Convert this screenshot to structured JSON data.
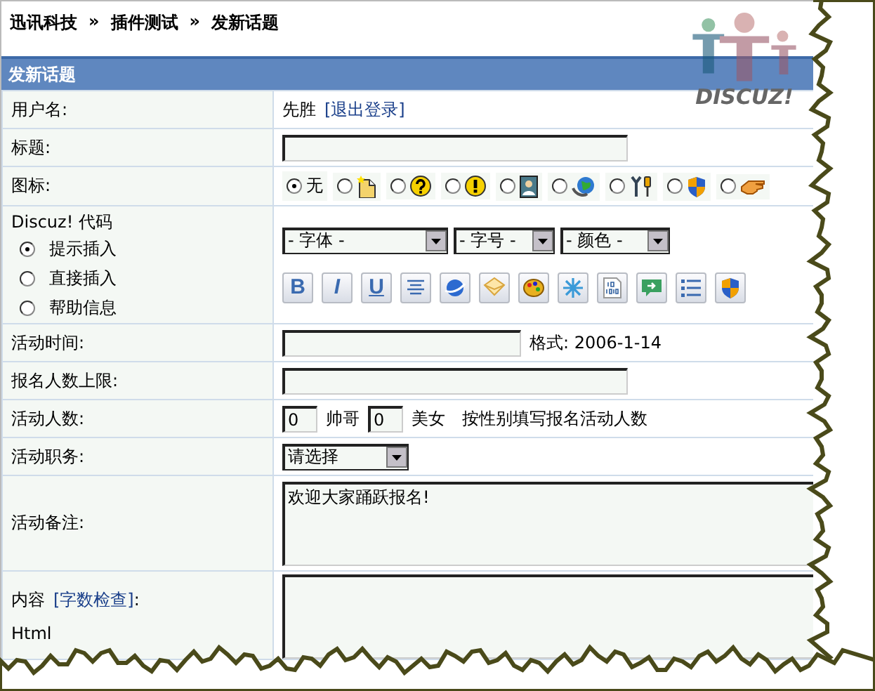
{
  "breadcrumb": [
    {
      "label": "迅讯科技"
    },
    {
      "separator": "»",
      "label": "插件测试"
    },
    {
      "separator": "»",
      "label": "发新话题"
    }
  ],
  "logo": {
    "text": "DISCUZ!"
  },
  "form": {
    "title": "发新话题",
    "rows": [
      {
        "kind": "user",
        "label": "用户名:",
        "user": "先胜",
        "link": "[退出登录]"
      },
      {
        "kind": "text",
        "label": "标题:",
        "value": ""
      },
      {
        "kind": "icons",
        "label": "图标:",
        "options": [
          {
            "text": "无",
            "selected": true
          },
          {
            "selected": false
          },
          {
            "selected": false
          },
          {
            "selected": false
          },
          {
            "selected": false
          },
          {
            "selected": false
          },
          {
            "selected": false
          },
          {
            "selected": false
          },
          {
            "selected": false
          }
        ]
      },
      {
        "kind": "editor",
        "label": "Discuz! 代码",
        "modes": [
          {
            "label": "提示插入",
            "selected": true
          },
          {
            "label": "直接插入",
            "selected": false
          },
          {
            "label": "帮助信息",
            "selected": false
          }
        ],
        "selects": [
          "- 字体 -",
          "- 字号 -",
          "- 颜色 -"
        ],
        "buttons": [
          {
            "kind": "bold",
            "text": "B"
          },
          {
            "kind": "italic",
            "text": "I"
          },
          {
            "kind": "underline",
            "text": "U"
          },
          {
            "kind": "center"
          },
          {
            "kind": "globe"
          },
          {
            "kind": "envelope"
          },
          {
            "kind": "palette"
          },
          {
            "kind": "sparkle"
          },
          {
            "kind": "binary"
          },
          {
            "kind": "bubble"
          },
          {
            "kind": "list"
          },
          {
            "kind": "shield"
          }
        ]
      },
      {
        "kind": "date",
        "label": "活动时间:",
        "value": "",
        "hint": "格式: 2006-1-14"
      },
      {
        "kind": "text",
        "label": "报名人数上限:",
        "value": ""
      },
      {
        "kind": "counts",
        "label": "活动人数:",
        "male": "0",
        "male_label": "帅哥",
        "female": "0",
        "female_label": "美女",
        "hint": "按性别填写报名活动人数"
      },
      {
        "kind": "select",
        "label": "活动职务:",
        "value": "请选择"
      },
      {
        "kind": "textarea",
        "label": "活动备注:",
        "value": "欢迎大家踊跃报名!"
      },
      {
        "kind": "content",
        "label": "内容",
        "link": "[字数检查]",
        "suffix": ":",
        "note": "Html"
      }
    ]
  }
}
